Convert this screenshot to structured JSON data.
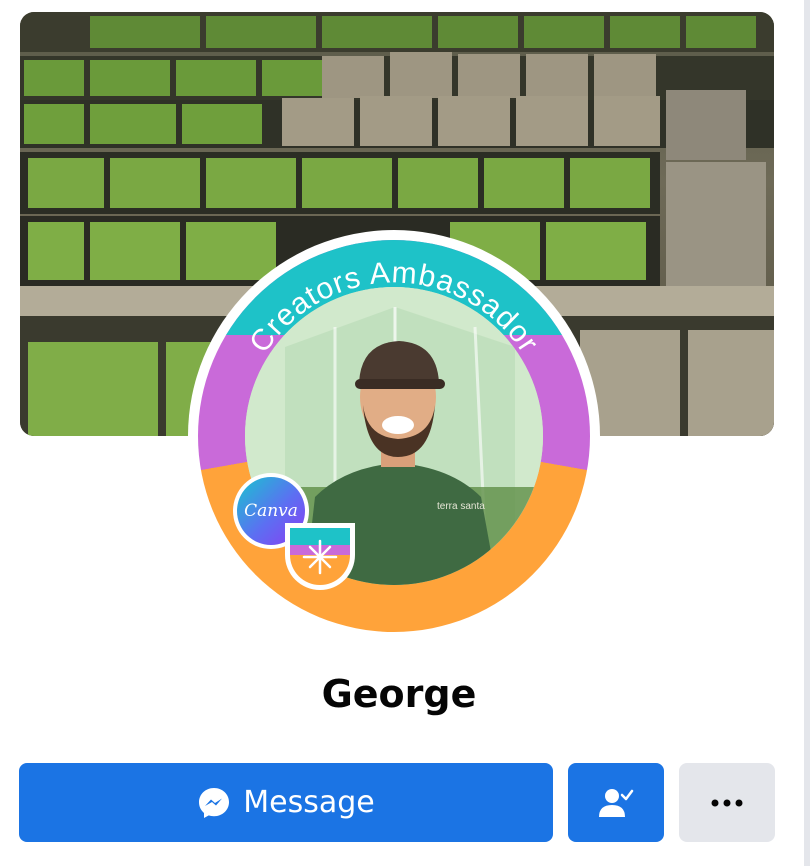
{
  "profile": {
    "name": "George",
    "frame_banner_text": "Creators Ambassador",
    "canva_badge_text": "Canva",
    "shirt_logo_text": "terra santa"
  },
  "actions": {
    "message_label": "Message",
    "friends_icon": "person-check-icon",
    "more_icon": "more-horizontal-icon"
  },
  "colors": {
    "primary_button": "#1b74e4",
    "secondary_button": "#e4e6eb",
    "frame_teal": "#1ec2c8",
    "frame_purple": "#c96ad9",
    "frame_orange": "#ffa33a"
  }
}
